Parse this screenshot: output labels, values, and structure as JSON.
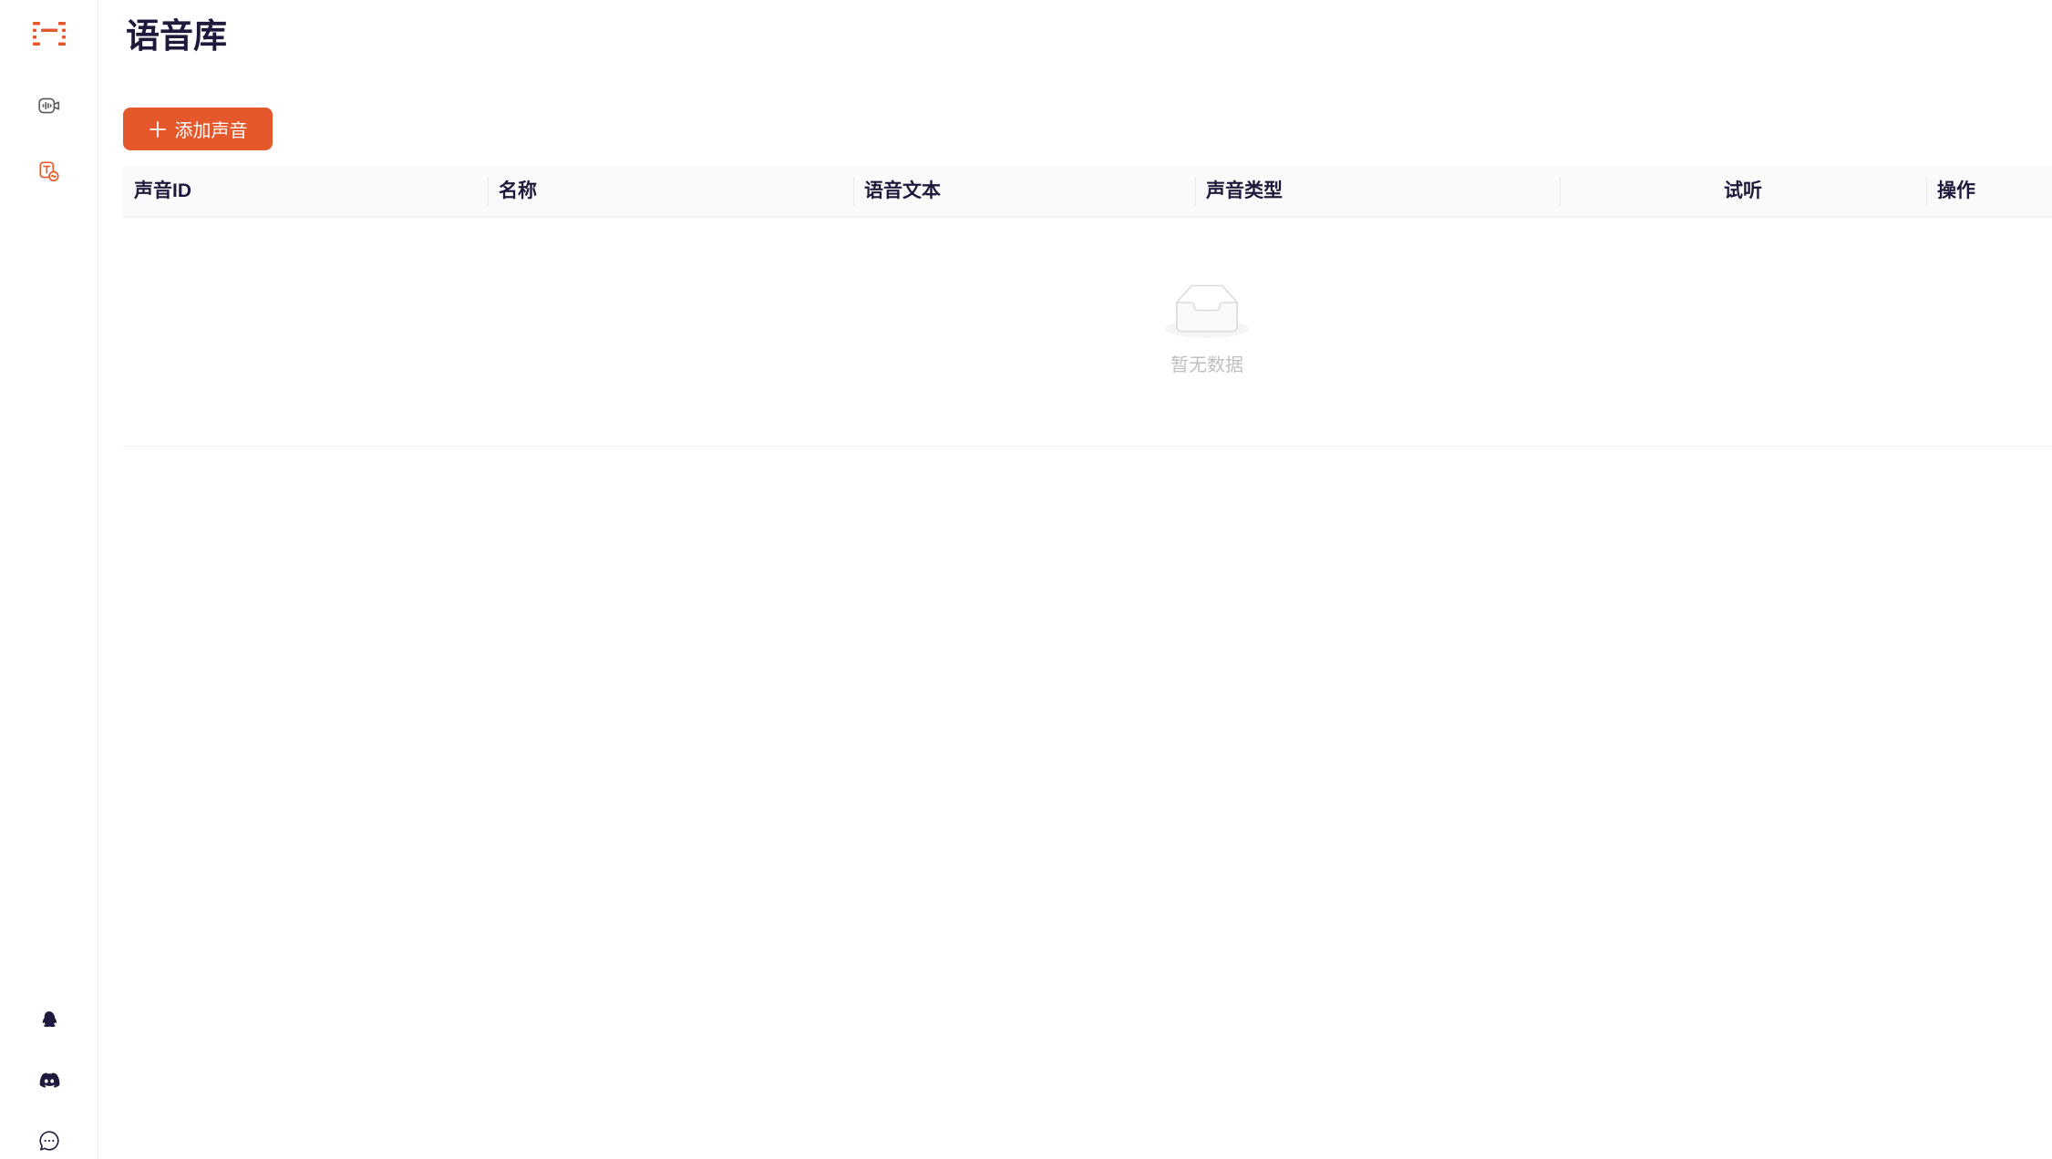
{
  "sidebar": {
    "logo_icon": "logo-icon",
    "nav": [
      {
        "icon": "video-waveform-icon",
        "active": false
      },
      {
        "icon": "text-voice-icon",
        "active": true
      }
    ],
    "footer": [
      {
        "icon": "qq-icon"
      },
      {
        "icon": "discord-icon"
      },
      {
        "icon": "chat-bubble-icon"
      }
    ]
  },
  "page": {
    "title": "语音库"
  },
  "toolbar": {
    "add_button": {
      "icon": "plus-icon",
      "label": "添加声音"
    }
  },
  "table": {
    "columns": [
      "声音ID",
      "名称",
      "语音文本",
      "声音类型",
      "试听",
      "操作"
    ],
    "rows": []
  },
  "empty_state": {
    "icon": "empty-inbox-icon",
    "text": "暂无数据"
  },
  "colors": {
    "accent": "#E4582B",
    "title": "#1E1A3C",
    "header_bg": "#FAFAFA",
    "muted_text": "#BFBFBF",
    "icon_gray": "#5A5A5A"
  }
}
